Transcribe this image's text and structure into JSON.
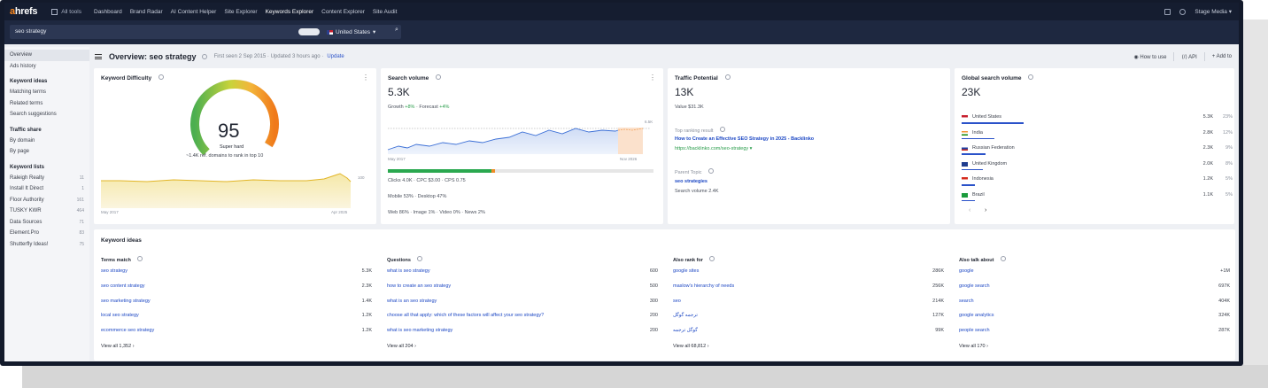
{
  "nav": {
    "logo_a": "a",
    "logo_rest": "hrefs",
    "all_tools": "All tools",
    "items": [
      "Dashboard",
      "Brand Radar",
      "AI Content Helper",
      "Site Explorer",
      "Keywords Explorer",
      "Content Explorer",
      "Site Audit"
    ],
    "active_index": 4,
    "account": "Stage Media"
  },
  "search": {
    "query": "seo strategy",
    "country": "United States"
  },
  "sidebar": {
    "top": [
      {
        "label": "Overview",
        "selected": true
      },
      {
        "label": "Ads history"
      }
    ],
    "keyword_ideas_head": "Keyword ideas",
    "keyword_ideas": [
      "Matching terms",
      "Related terms",
      "Search suggestions"
    ],
    "traffic_share_head": "Traffic share",
    "traffic_share": [
      "By domain",
      "By page"
    ],
    "keyword_lists_head": "Keyword lists",
    "keyword_lists": [
      {
        "label": "Raleigh Realty",
        "count": "11"
      },
      {
        "label": "Install It Direct",
        "count": "1"
      },
      {
        "label": "Floor Authority",
        "count": "161"
      },
      {
        "label": "TUSKY KWR",
        "count": "464"
      },
      {
        "label": "Data Sources",
        "count": "71"
      },
      {
        "label": "Element.Pro",
        "count": "83"
      },
      {
        "label": "Shutterfly Ideas!",
        "count": "75"
      }
    ]
  },
  "overview": {
    "title": "Overview: seo strategy",
    "meta": "First seen 2 Sep 2015 · Updated 3 hours ago ·",
    "update": "Update",
    "how_to_use": "How to use",
    "api": "API",
    "add_to": "Add to"
  },
  "kd": {
    "title": "Keyword Difficulty",
    "score": "95",
    "label": "Super hard",
    "note": "~1.4K ref. domains to rank in top 10",
    "score_fraction": 0.95,
    "axis_start": "May 2017",
    "axis_end": "Apr 2025",
    "right_tick": "100"
  },
  "sv": {
    "title": "Search volume",
    "value": "5.3K",
    "growth_label": "Growth",
    "growth": "+8%",
    "forecast_label": "Forecast",
    "forecast": "+4%",
    "axis_start": "May 2017",
    "axis_end": "Nov 2026",
    "right_tick": "6.5K",
    "clicks": "Clicks 4.0K · CPC $3.00 · CPS 0.75",
    "clicks_fraction": 0.75,
    "devices": "Mobile 53% · Desktop 47%",
    "serp": "Web 86% · Image 1% · Video 0% · News 2%"
  },
  "tp": {
    "title": "Traffic Potential",
    "value": "13K",
    "value_sub": "Value $31.3K",
    "top_label": "Top ranking result",
    "top_title": "How to Create an Effective SEO Strategy in 2025 - Backlinko",
    "top_url": "https://backlinko.com/seo-strategy ▾",
    "parent_label": "Parent Topic",
    "parent_topic": "seo strategies",
    "parent_volume": "Search volume 2.4K"
  },
  "gsv": {
    "title": "Global search volume",
    "value": "23K",
    "countries": [
      {
        "name": "United States",
        "value": "5.3K",
        "pct": "23%",
        "share": 0.23,
        "flag": "us"
      },
      {
        "name": "India",
        "value": "2.8K",
        "pct": "12%",
        "share": 0.12,
        "flag": "in"
      },
      {
        "name": "Russian Federation",
        "value": "2.3K",
        "pct": "9%",
        "share": 0.09,
        "flag": "ru"
      },
      {
        "name": "United Kingdom",
        "value": "2.0K",
        "pct": "8%",
        "share": 0.08,
        "flag": "uk"
      },
      {
        "name": "Indonesia",
        "value": "1.2K",
        "pct": "5%",
        "share": 0.05,
        "flag": "id"
      },
      {
        "name": "Brazil",
        "value": "1.1K",
        "pct": "5%",
        "share": 0.05,
        "flag": "br"
      }
    ]
  },
  "ideas": {
    "title": "Keyword ideas",
    "columns": [
      {
        "head": "Terms match",
        "rows": [
          [
            "seo strategy",
            "5.3K"
          ],
          [
            "seo content strategy",
            "2.3K"
          ],
          [
            "seo marketing strategy",
            "1.4K"
          ],
          [
            "local seo strategy",
            "1.2K"
          ],
          [
            "ecommerce seo strategy",
            "1.2K"
          ]
        ],
        "view_all": "View all 1,352"
      },
      {
        "head": "Questions",
        "rows": [
          [
            "what is seo strategy",
            "600"
          ],
          [
            "how to create an seo strategy",
            "500"
          ],
          [
            "what is an seo strategy",
            "300"
          ],
          [
            "choose all that apply: which of these factors will affect your seo strategy?",
            "200"
          ],
          [
            "what is seo marketing strategy",
            "200"
          ]
        ],
        "view_all": "View all 204"
      },
      {
        "head": "Also rank for",
        "rows": [
          [
            "google sites",
            "286K"
          ],
          [
            "maslow's hierarchy of needs",
            "256K"
          ],
          [
            "seo",
            "214K"
          ],
          [
            "ترجمه گوگل",
            "127K"
          ],
          [
            "گوگل ترجمه",
            "99K"
          ]
        ],
        "view_all": "View all 68,812"
      },
      {
        "head": "Also talk about",
        "rows": [
          [
            "google",
            "+1M"
          ],
          [
            "google search",
            "697K"
          ],
          [
            "search",
            "404K"
          ],
          [
            "google analytics",
            "324K"
          ],
          [
            "people search",
            "287K"
          ]
        ],
        "view_all": "View all 170"
      }
    ]
  },
  "colors": {
    "accent": "#1d48c4",
    "nav": "#151d30",
    "orange": "#ff8a1e",
    "green": "#2a9d4b"
  }
}
